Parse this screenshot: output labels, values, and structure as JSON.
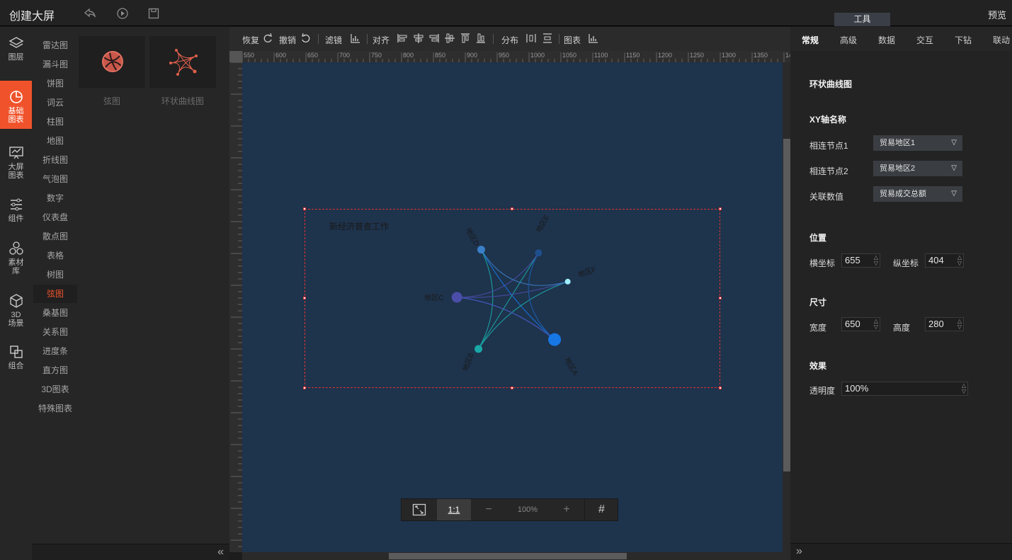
{
  "header": {
    "title": "创建大屏",
    "preview_label": "预览",
    "tools_tab": "工具"
  },
  "leftnav": {
    "items": [
      {
        "label": "图层",
        "icon": "layers-icon"
      },
      {
        "label": "基础\n图表",
        "icon": "pie-chart-icon",
        "active": true
      },
      {
        "label": "大屏\n图表",
        "icon": "monitor-chart-icon"
      },
      {
        "label": "组件",
        "icon": "sliders-icon"
      },
      {
        "label": "素材\n库",
        "icon": "hexagons-icon"
      },
      {
        "label": "3D\n场景",
        "icon": "cube-icon"
      },
      {
        "label": "组合",
        "icon": "combine-icon"
      }
    ]
  },
  "categories": [
    "雷达图",
    "漏斗图",
    "饼图",
    "词云",
    "柱图",
    "地图",
    "折线图",
    "气泡图",
    "数字",
    "仪表盘",
    "散点图",
    "表格",
    "树图",
    "弦图",
    "桑基图",
    "关系图",
    "进度条",
    "直方图",
    "3D图表",
    "特殊图表"
  ],
  "active_category": "弦图",
  "thumbnails": [
    {
      "label": "弦图"
    },
    {
      "label": "环状曲线图"
    }
  ],
  "toolbar": {
    "redo": "恢复",
    "undo": "撤销",
    "filter": "滤镜",
    "align": "对齐",
    "distribute": "分布",
    "chart": "图表"
  },
  "ruler": {
    "ticks": [
      "550",
      "600",
      "650",
      "700",
      "750",
      "800",
      "850",
      "900",
      "950",
      "1000",
      "1050",
      "1100",
      "1150",
      "1200",
      "1250",
      "1300",
      "1350",
      "14"
    ]
  },
  "canvas": {
    "chart_title": "新经济普查工作",
    "nodes": [
      {
        "label": "地区A",
        "color": "#1677e5"
      },
      {
        "label": "地区B",
        "color": "#1aa7a7"
      },
      {
        "label": "地区C",
        "color": "#4a4ea8"
      },
      {
        "label": "地区D",
        "color": "#3a7fc8"
      },
      {
        "label": "地区E",
        "color": "#1f4f8c"
      },
      {
        "label": "地区F",
        "color": "#9ff0ff"
      }
    ]
  },
  "zoom": {
    "fit": "⤢",
    "one_to_one": "1:1",
    "minus": "−",
    "level": "100%",
    "plus": "+",
    "grid": "#"
  },
  "rpanel": {
    "tabs": [
      "常规",
      "高级",
      "数据",
      "交互",
      "下钻",
      "联动"
    ],
    "chart_name": "环状曲线图",
    "xy_heading": "XY轴名称",
    "fields": [
      {
        "label": "相连节点1",
        "value": "贸易地区1"
      },
      {
        "label": "相连节点2",
        "value": "贸易地区2"
      },
      {
        "label": "关联数值",
        "value": "贸易成交总额"
      }
    ],
    "position_heading": "位置",
    "x_label": "横坐标",
    "x_value": "655",
    "y_label": "纵坐标",
    "y_value": "404",
    "size_heading": "尺寸",
    "w_label": "宽度",
    "w_value": "650",
    "h_label": "高度",
    "h_value": "280",
    "effect_heading": "效果",
    "opacity_label": "透明度",
    "opacity_value": "100%"
  }
}
